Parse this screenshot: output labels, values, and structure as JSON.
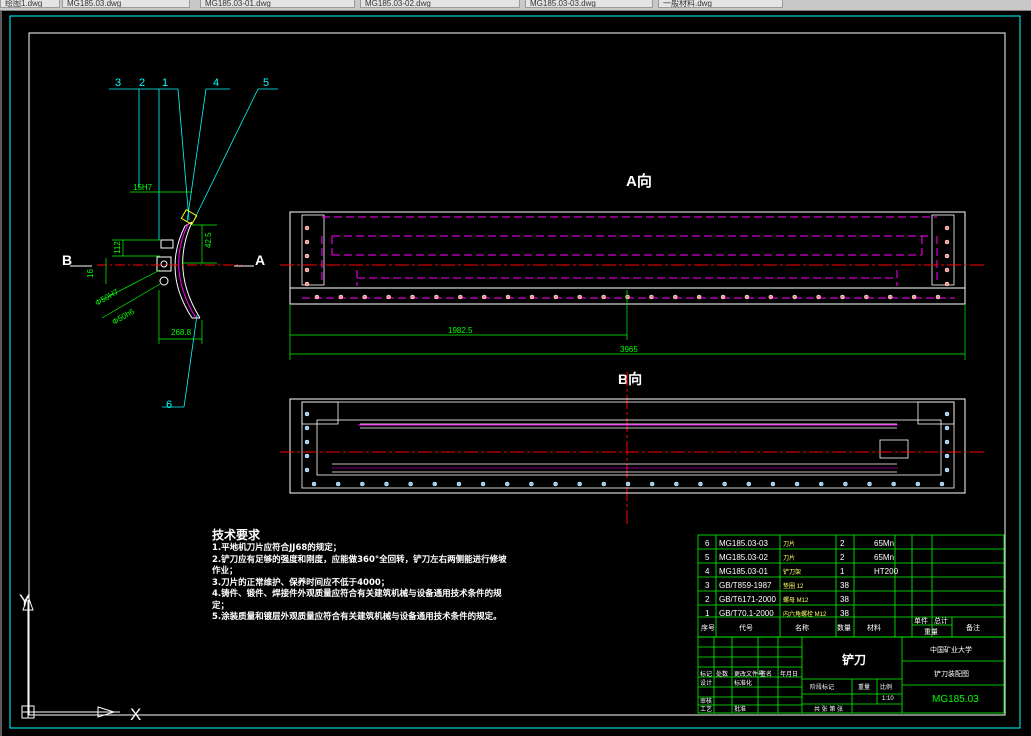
{
  "app": {
    "tabs": [
      {
        "label": "绘图1.dwg"
      },
      {
        "label": "MG185.03.dwg"
      },
      {
        "label": "MG185.03-01.dwg"
      },
      {
        "label": "MG185.03-02.dwg"
      },
      {
        "label": "MG185.03-03.dwg"
      },
      {
        "label": "一般材料.dwg"
      }
    ]
  },
  "colors": {
    "background": "#000000",
    "frame": "#ffffff",
    "dimension": "#00ff00",
    "leader": "#00ffff",
    "hidden": "#ff00ff",
    "center": "#ff0000",
    "text": "#ffffff",
    "title_block": "#00ff00"
  },
  "side_view": {
    "balloons": [
      "3",
      "2",
      "1",
      "4",
      "5",
      "6"
    ],
    "dims": {
      "top": "15H7",
      "left_small": "112",
      "mid": "16",
      "right": "42.5",
      "dia1": "Φ50H7",
      "dia2": "Φ50h6",
      "bottom": "268.8"
    },
    "section_left": "B",
    "section_right": "A"
  },
  "view_a": {
    "title": "A向",
    "dim_half": "1982.5",
    "dim_total": "3965"
  },
  "view_b": {
    "title": "B向"
  },
  "notes": {
    "title": "技术要求",
    "lines": [
      "1.平地机刀片应符合JJ68的规定；",
      "2.铲刀应有足够的强度和刚度，应能做360°全回转，铲刀左右两侧能进行修坡作业；",
      "3.刀片的正常维护、保养时间应不低于4000；",
      "4.铸件、锻件、焊接件外观质量应符合有关建筑机械与设备通用技术条件的规定；",
      "5.涂装质量和镀层外观质量应符合有关建筑机械与设备通用技术条件的规定。"
    ]
  },
  "bom": {
    "rows": [
      {
        "no": "6",
        "code": "MG185.03-03",
        "name": "刀片",
        "qty": "2",
        "material": "65Mn"
      },
      {
        "no": "5",
        "code": "MG185.03-02",
        "name": "刀片",
        "qty": "2",
        "material": "65Mn"
      },
      {
        "no": "4",
        "code": "MG185.03-01",
        "name": "铲刀架",
        "qty": "1",
        "material": "HT200"
      },
      {
        "no": "3",
        "code": "GB/T859-1987",
        "name": "垫圈 12",
        "qty": "38",
        "material": ""
      },
      {
        "no": "2",
        "code": "GB/T6171-2000",
        "name": "螺母 M12",
        "qty": "38",
        "material": ""
      },
      {
        "no": "1",
        "code": "GB/T70.1-2000",
        "name": "内六角螺栓 M12",
        "qty": "38",
        "material": ""
      }
    ],
    "header": {
      "no": "序号",
      "code": "代号",
      "name": "名称",
      "qty": "数量",
      "material": "材料",
      "single": "单件",
      "total": "总计",
      "weight": "重量",
      "remark": "备注"
    }
  },
  "title_block": {
    "part_name": "铲刀",
    "school": "中国矿业大学",
    "dept": "铲刀装配图",
    "drawing_no": "MG185.03",
    "scale_label": "比例",
    "scale_value": "1:10",
    "stage_label": "阶段标记",
    "weight_label": "重量",
    "sheet_label": "共 张 第 张",
    "designer": "设计",
    "checker": "审核",
    "craft": "工艺",
    "mark": "标记",
    "count": "处数",
    "zone": "分区",
    "change_no": "更改文件号",
    "signature": "签名",
    "date": "年月日",
    "std": "标准化",
    "approve": "批准"
  },
  "ucs": {
    "x_label": "X",
    "y_label": "Y"
  }
}
